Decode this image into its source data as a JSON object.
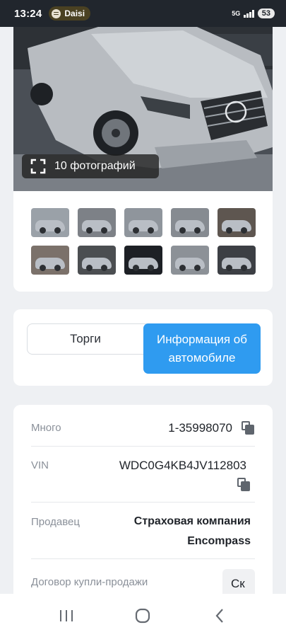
{
  "status_bar": {
    "time": "13:24",
    "media_app": "Daisi",
    "network": "5G",
    "battery": "53"
  },
  "gallery": {
    "photo_count_label": "10 фотографий",
    "thumbnails": [
      {
        "bg": "#9aa1a8"
      },
      {
        "bg": "#7d8187"
      },
      {
        "bg": "#8f959c"
      },
      {
        "bg": "#868b91"
      },
      {
        "bg": "#5e5650"
      },
      {
        "bg": "#7b716a"
      },
      {
        "bg": "#4b4e51"
      },
      {
        "bg": "#1d2025"
      },
      {
        "bg": "#8c9197"
      },
      {
        "bg": "#3c3f44"
      }
    ]
  },
  "tabs": {
    "auction": "Торги",
    "vehicle_info": "Информация об автомобиле",
    "active": "vehicle_info"
  },
  "details": {
    "lot": {
      "label": "Много",
      "value": "1-35998070"
    },
    "vin": {
      "label": "VIN",
      "value": "WDC0G4KB4JV112803"
    },
    "seller": {
      "label": "Продавец",
      "value_line1": "Страховая компания",
      "value_line2": "Encompass"
    },
    "contract": {
      "label": "Договор купли-продажи",
      "value": "Ск"
    }
  },
  "colors": {
    "accent": "#2f9bf0",
    "background": "#eef0f3",
    "card": "#ffffff",
    "label": "#8a9099"
  }
}
